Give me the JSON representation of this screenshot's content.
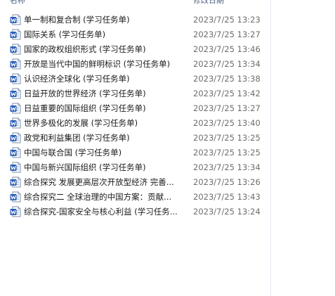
{
  "columns": {
    "name": "名称",
    "date": "修改日期"
  },
  "icon": "word-document-icon",
  "files": [
    {
      "name": "单一制和复合制 (学习任务单)",
      "date": "2023/7/25 13:23"
    },
    {
      "name": "国际关系 (学习任务单)",
      "date": "2023/7/25 13:27"
    },
    {
      "name": "国家的政权组织形式 (学习任务单)",
      "date": "2023/7/25 13:46"
    },
    {
      "name": "开放是当代中国的鲜明标识 (学习任务单)",
      "date": "2023/7/25 13:34"
    },
    {
      "name": "认识经济全球化 (学习任务单)",
      "date": "2023/7/25 13:38"
    },
    {
      "name": "日益开放的世界经济 (学习任务单)",
      "date": "2023/7/25 13:42"
    },
    {
      "name": "日益重要的国际组织 (学习任务单)",
      "date": "2023/7/25 13:27"
    },
    {
      "name": "世界多极化的发展 (学习任务单)",
      "date": "2023/7/25 13:40"
    },
    {
      "name": "政党和利益集团 (学习任务单)",
      "date": "2023/7/25 13:25"
    },
    {
      "name": "中国与联合国 (学习任务单)",
      "date": "2023/7/25 13:25"
    },
    {
      "name": "中国与新兴国际组织 (学习任务单)",
      "date": "2023/7/25 13:34"
    },
    {
      "name": "综合探究 发展更高层次开放型经济 完善...",
      "date": "2023/7/25 13:26"
    },
    {
      "name": "综合探究二 全球治理的中国方案：贡献...",
      "date": "2023/7/25 13:43"
    },
    {
      "name": "综合探究-国家安全与核心利益 (学习任务...",
      "date": "2023/7/25 13:24"
    }
  ]
}
